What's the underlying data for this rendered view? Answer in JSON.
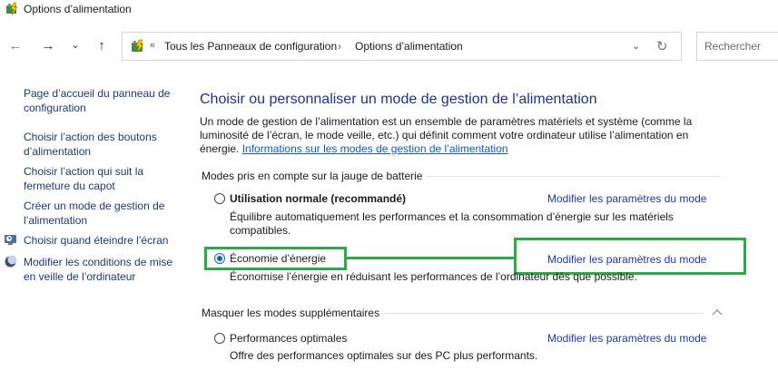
{
  "window": {
    "title": "Options d’alimentation",
    "icon": "power-options-icon"
  },
  "nav": {
    "back": "←",
    "forward": "→",
    "recent": "⌄",
    "up": "↑"
  },
  "address": {
    "chevron": "«",
    "crumbs": [
      "Tous les Panneaux de configuration",
      "Options d’alimentation"
    ],
    "separator": "›",
    "dropdown": "⌄",
    "refresh": "↻"
  },
  "search": {
    "placeholder": "Rechercher"
  },
  "sidebar": {
    "items": [
      {
        "label": "Page d’accueil du panneau de configuration"
      },
      {
        "label": "Choisir l’action des boutons d’alimentation"
      },
      {
        "label": "Choisir l’action qui suit la fermeture du capot"
      },
      {
        "label": "Créer un mode de gestion de l’alimentation"
      },
      {
        "label": "Choisir quand éteindre l’écran",
        "icon": "display-timer-icon"
      },
      {
        "label": "Modifier les conditions de mise en veille de l’ordinateur",
        "icon": "moon-sleep-icon"
      }
    ]
  },
  "main": {
    "heading": "Choisir ou personnaliser un mode de gestion de l’alimentation",
    "description": "Un mode de gestion de l’alimentation est un ensemble de paramètres matériels et système (comme la luminosité de l’écran, le mode veille, etc.) qui définit comment votre ordinateur utilise l’alimentation en énergie.",
    "info_link": "Informations sur les modes de gestion de l’alimentation",
    "section_battery": "Modes pris en compte sur la jauge de batterie",
    "section_more": "Masquer les modes supplémentaires",
    "collapse_icon": "chevron-up-icon",
    "plans": [
      {
        "name": "Utilisation normale (recommandé)",
        "selected": false,
        "description": "Équilibre automatiquement les performances et la consommation d’énergie sur les matériels compatibles.",
        "link": "Modifier les paramètres du mode"
      },
      {
        "name": "Économie d’énergie",
        "selected": true,
        "description": "Économise l’énergie en réduisant les performances de l’ordinateur dès que possible.",
        "link": "Modifier les paramètres du mode"
      },
      {
        "name": "Performances optimales",
        "selected": false,
        "description": "Offre des performances optimales sur des PC plus performants.",
        "link": "Modifier les paramètres du mode"
      }
    ]
  },
  "colors": {
    "heading": "#1e3287",
    "link": "#0b57d0",
    "highlight": "#2fa84a",
    "radio": "#0a64c8"
  }
}
